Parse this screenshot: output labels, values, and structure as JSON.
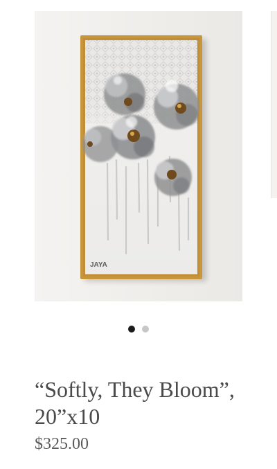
{
  "product": {
    "title": "“Softly, They Bloom”, 20”x10",
    "price": "$325.00",
    "image_alt": "Softly, They Bloom painting"
  },
  "gallery": {
    "slide_count": 2,
    "active_index": 0
  },
  "artwork": {
    "signature": "JAYA",
    "frame_color": "#c8963a",
    "petal_color": "#8f9092",
    "center_color": "#6e4a1c"
  }
}
